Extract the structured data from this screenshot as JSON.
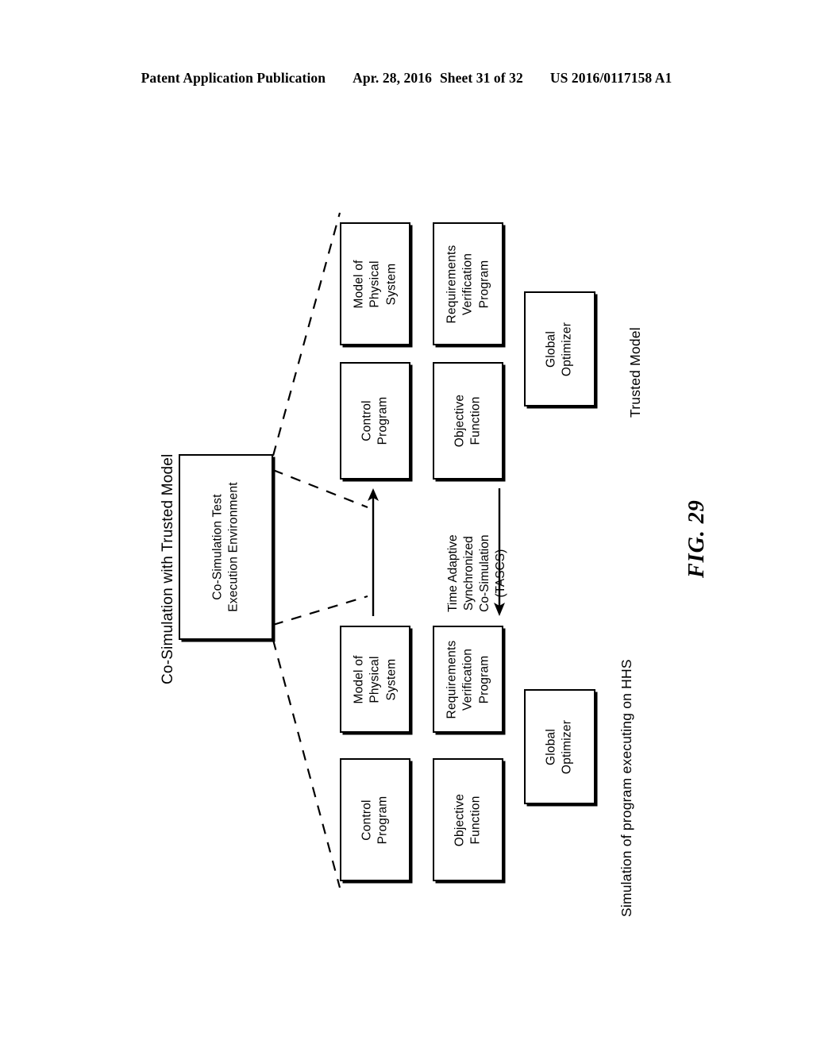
{
  "header": {
    "publication": "Patent Application Publication",
    "date": "Apr. 28, 2016",
    "sheet": "Sheet 31 of 32",
    "number": "US 2016/0117158 A1"
  },
  "figure": {
    "label": "FIG. 29"
  },
  "diagram": {
    "left_caption": "Co-Simulation with Trusted Model",
    "center_node": {
      "line1": "Co-Simulation Test",
      "line2": "Execution Environment"
    },
    "middle_label": {
      "line1": "Time Adaptive",
      "line2": "Synchronized",
      "line3": "Co-Simulation",
      "line4": "(TASCS)"
    },
    "top_group": {
      "caption": "Trusted Model",
      "nodes": [
        {
          "name": "model-of-physical-system",
          "line1": "Model of",
          "line2": "Physical",
          "line3": "System"
        },
        {
          "name": "requirements-verification-program",
          "line1": "Requirements",
          "line2": "Verification",
          "line3": "Program"
        },
        {
          "name": "control-program",
          "line1": "Control",
          "line2": "Program",
          "line3": ""
        },
        {
          "name": "objective-function",
          "line1": "Objective",
          "line2": "Function",
          "line3": ""
        },
        {
          "name": "global-optimizer",
          "line1": "Global",
          "line2": "Optimizer",
          "line3": ""
        }
      ]
    },
    "bottom_group": {
      "caption": "Simulation of program executing on HHS",
      "nodes": [
        {
          "name": "model-of-physical-system",
          "line1": "Model of",
          "line2": "Physical",
          "line3": "System"
        },
        {
          "name": "requirements-verification-program",
          "line1": "Requirements",
          "line2": "Verification",
          "line3": "Program"
        },
        {
          "name": "control-program",
          "line1": "Control",
          "line2": "Program",
          "line3": ""
        },
        {
          "name": "objective-function",
          "line1": "Objective",
          "line2": "Function",
          "line3": ""
        },
        {
          "name": "global-optimizer",
          "line1": "Global",
          "line2": "Optimizer",
          "line3": ""
        }
      ]
    },
    "arrows": {
      "up_arrow": "arrow-up",
      "down_arrow": "arrow-down"
    },
    "colors": {
      "stroke": "#000000",
      "fill": "#ffffff"
    }
  }
}
